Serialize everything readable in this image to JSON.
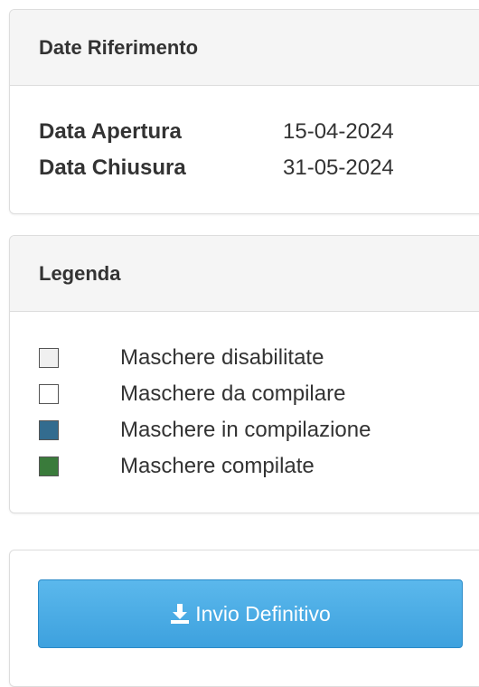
{
  "reference_dates": {
    "title": "Date Riferimento",
    "opening": {
      "label": "Data Apertura",
      "value": "15-04-2024"
    },
    "closing": {
      "label": "Data Chiusura",
      "value": "31-05-2024"
    }
  },
  "legend": {
    "title": "Legenda",
    "items": [
      {
        "label": "Maschere disabilitate",
        "color": "#f0f0f0"
      },
      {
        "label": "Maschere da compilare",
        "color": "#ffffff"
      },
      {
        "label": "Maschere in compilazione",
        "color": "#336c8f"
      },
      {
        "label": "Maschere compilate",
        "color": "#3a7b3b"
      }
    ]
  },
  "actions": {
    "submit_label": "Invio Definitivo",
    "submit_icon": "download-icon",
    "submit_color": "#3da1de"
  }
}
